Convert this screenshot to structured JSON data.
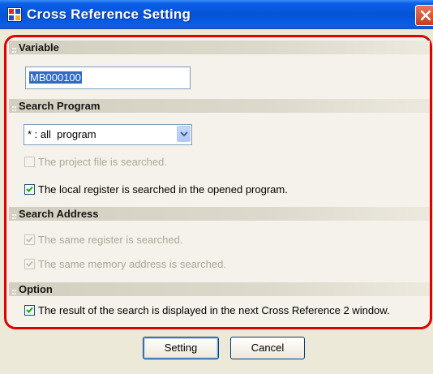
{
  "window": {
    "title": "Cross Reference Setting",
    "app_icon": "app-icon",
    "close_icon": "close-icon"
  },
  "sections": {
    "variable": "Variable",
    "search_program": "Search Program",
    "search_address": "Search Address",
    "option": "Option"
  },
  "variable": {
    "value": "MB000100"
  },
  "search_program": {
    "selected": "* : all  program",
    "project_file": {
      "label": "The project file is searched.",
      "checked": false,
      "enabled": false
    },
    "local_register": {
      "label": "The local register is searched in the opened program.",
      "checked": true,
      "enabled": true
    }
  },
  "search_address": {
    "same_register": {
      "label": "The same register is searched.",
      "checked": true,
      "enabled": false
    },
    "same_memory": {
      "label": "The same memory address is searched.",
      "checked": true,
      "enabled": false
    }
  },
  "option": {
    "display_result": {
      "label": "The result of the search is displayed in the next Cross Reference 2 window.",
      "checked": true,
      "enabled": true
    }
  },
  "buttons": {
    "setting": "Setting",
    "cancel": "Cancel"
  },
  "colors": {
    "highlight_frame": "#e00000",
    "title_bar": "#0553d6",
    "selection": "#316ac5"
  }
}
